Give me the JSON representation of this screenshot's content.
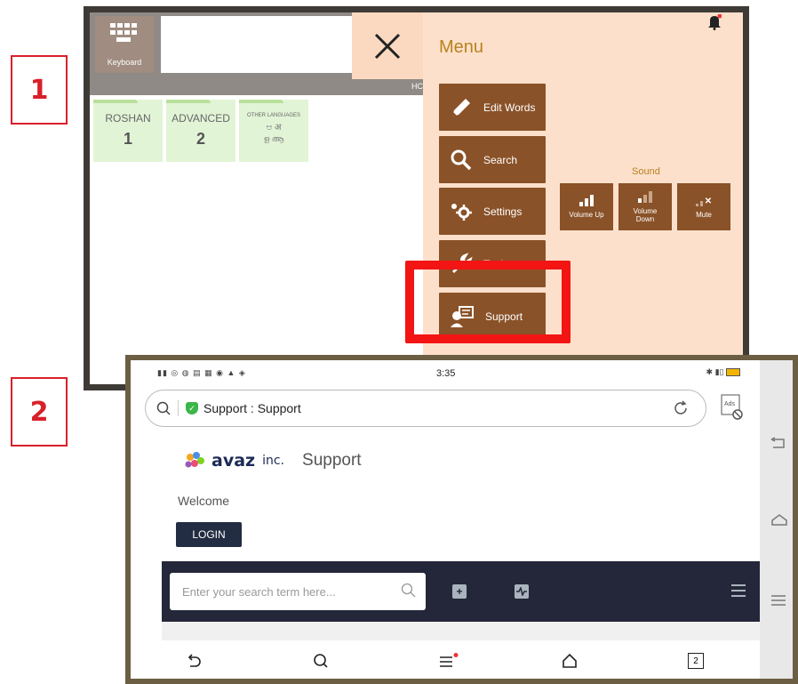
{
  "labels": {
    "step1": "1",
    "step2": "2"
  },
  "app1": {
    "keyboard_label": "Keyboard",
    "hidden_text": "HC",
    "folders": [
      {
        "name": "ROSHAN",
        "value": "1"
      },
      {
        "name": "ADVANCED",
        "value": "2"
      },
      {
        "name": "OTHER LANGUAGES",
        "script1": "ಆ अ",
        "script2": "ള ആ"
      }
    ],
    "menu": {
      "title": "Menu",
      "items": [
        "Edit Words",
        "Search",
        "Settings",
        "Tools",
        "Support"
      ],
      "sound_label": "Sound",
      "sound_buttons": [
        [
          "Volume Up"
        ],
        [
          "Volume",
          "Down"
        ],
        [
          "Mute"
        ]
      ]
    }
  },
  "app2": {
    "status_time": "3:35",
    "url_title": "Support : Support",
    "ads_label": "Ads",
    "brand": "avaz",
    "brand_suffix": "inc.",
    "page_title": "Support",
    "welcome": "Welcome",
    "login_label": "LOGIN",
    "search_placeholder": "Enter your search term here...",
    "tab_count": "2"
  },
  "colors": {
    "accent_red": "#f31414",
    "menu_brown": "#8a5228",
    "menu_bg": "#fde0cb",
    "folder_green": "#e2f4d6",
    "dark_band": "#242739"
  }
}
